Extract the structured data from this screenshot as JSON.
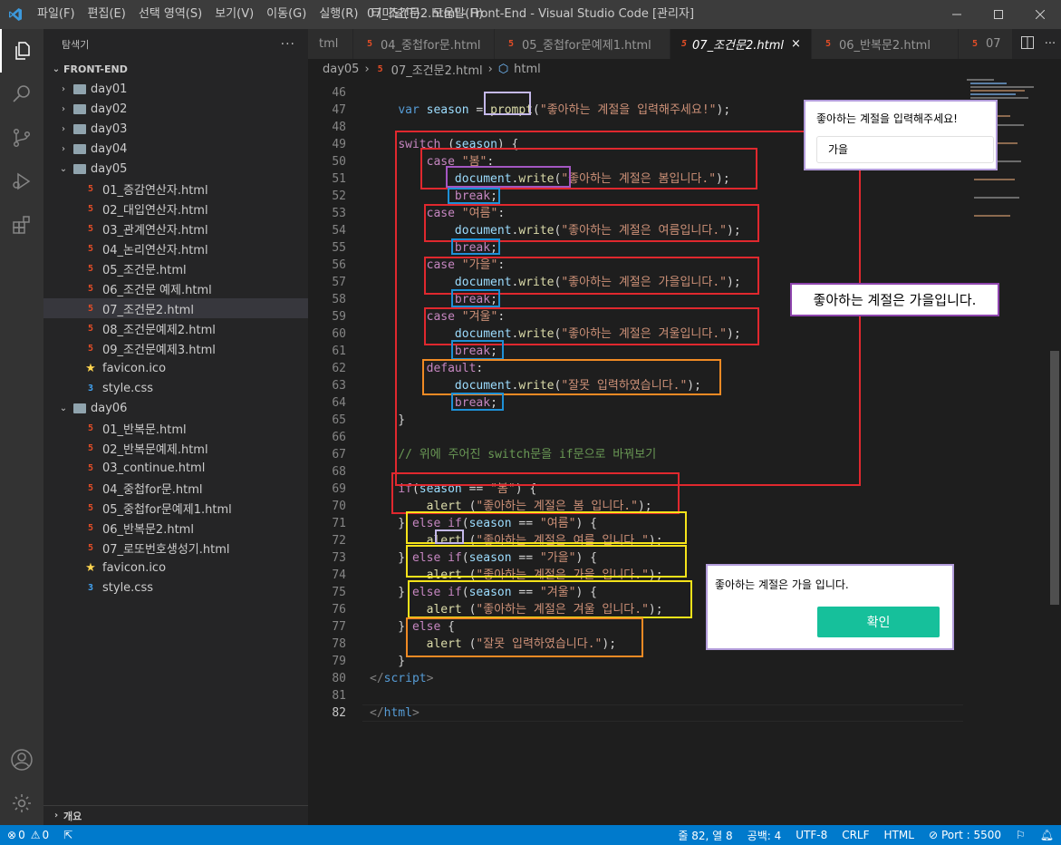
{
  "window": {
    "title": "07_조건문2.html - Front-End - Visual Studio Code [관리자]"
  },
  "menu": [
    "파일(F)",
    "편집(E)",
    "선택 영역(S)",
    "보기(V)",
    "이동(G)",
    "실행(R)",
    "터미널(T)",
    "도움말(H)"
  ],
  "sidebar": {
    "header": "탐색기",
    "section": "FRONT-END",
    "outline": "개요",
    "tree": [
      {
        "label": "day01",
        "kind": "folder",
        "open": false,
        "depth": 1
      },
      {
        "label": "day02",
        "kind": "folder",
        "open": false,
        "depth": 1
      },
      {
        "label": "day03",
        "kind": "folder",
        "open": false,
        "depth": 1
      },
      {
        "label": "day04",
        "kind": "folder",
        "open": false,
        "depth": 1
      },
      {
        "label": "day05",
        "kind": "folder",
        "open": true,
        "depth": 1
      },
      {
        "label": "01_증감연산자.html",
        "kind": "html",
        "depth": 2
      },
      {
        "label": "02_대입연산자.html",
        "kind": "html",
        "depth": 2
      },
      {
        "label": "03_관계연산자.html",
        "kind": "html",
        "depth": 2
      },
      {
        "label": "04_논리연산자.html",
        "kind": "html",
        "depth": 2
      },
      {
        "label": "05_조건문.html",
        "kind": "html",
        "depth": 2
      },
      {
        "label": "06_조건문 예제.html",
        "kind": "html",
        "depth": 2
      },
      {
        "label": "07_조건문2.html",
        "kind": "html",
        "depth": 2,
        "selected": true
      },
      {
        "label": "08_조건문예제2.html",
        "kind": "html",
        "depth": 2
      },
      {
        "label": "09_조건문예제3.html",
        "kind": "html",
        "depth": 2
      },
      {
        "label": "favicon.ico",
        "kind": "ico",
        "depth": 2
      },
      {
        "label": "style.css",
        "kind": "css",
        "depth": 2
      },
      {
        "label": "day06",
        "kind": "folder",
        "open": true,
        "depth": 1
      },
      {
        "label": "01_반복문.html",
        "kind": "html",
        "depth": 2
      },
      {
        "label": "02_반복문예제.html",
        "kind": "html",
        "depth": 2
      },
      {
        "label": "03_continue.html",
        "kind": "html",
        "depth": 2
      },
      {
        "label": "04_중첩for문.html",
        "kind": "html",
        "depth": 2
      },
      {
        "label": "05_중첩for문예제1.html",
        "kind": "html",
        "depth": 2
      },
      {
        "label": "06_반복문2.html",
        "kind": "html",
        "depth": 2
      },
      {
        "label": "07_로또번호생성기.html",
        "kind": "html",
        "depth": 2
      },
      {
        "label": "favicon.ico",
        "kind": "ico",
        "depth": 2
      },
      {
        "label": "style.css",
        "kind": "css",
        "depth": 2
      }
    ]
  },
  "tabs": [
    {
      "label": "tml",
      "icon": false
    },
    {
      "label": "04_중첩for문.html",
      "icon": true
    },
    {
      "label": "05_중첩for문예제1.html",
      "icon": true
    },
    {
      "label": "07_조건문2.html",
      "icon": true,
      "active": true,
      "close": "×"
    },
    {
      "label": "06_반복문2.html",
      "icon": true
    },
    {
      "label": "07",
      "icon": true
    }
  ],
  "breadcrumb": [
    "day05",
    "07_조건문2.html",
    "html"
  ],
  "code": [
    {
      "n": 46,
      "t": []
    },
    {
      "n": 47,
      "t": [
        [
          "    ",
          ""
        ],
        [
          "var ",
          "kw"
        ],
        [
          "season",
          "vr"
        ],
        [
          " = ",
          ""
        ],
        [
          "prompt",
          "fn"
        ],
        [
          "(",
          ""
        ],
        [
          "\"좋아하는 계절을 입력해주세요!\"",
          "st"
        ],
        [
          ");",
          ""
        ]
      ]
    },
    {
      "n": 48,
      "t": []
    },
    {
      "n": 49,
      "t": [
        [
          "    ",
          ""
        ],
        [
          "switch",
          "kc"
        ],
        [
          " (",
          ""
        ],
        [
          "season",
          "vr"
        ],
        [
          ") {",
          ""
        ]
      ]
    },
    {
      "n": 50,
      "t": [
        [
          "        ",
          ""
        ],
        [
          "case",
          "kc"
        ],
        [
          " ",
          ""
        ],
        [
          "\"봄\"",
          "st"
        ],
        [
          ":",
          ""
        ]
      ]
    },
    {
      "n": 51,
      "t": [
        [
          "            ",
          ""
        ],
        [
          "document",
          "vr"
        ],
        [
          ".",
          ""
        ],
        [
          "write",
          "fn"
        ],
        [
          "(",
          ""
        ],
        [
          "\"좋아하는 계절은 봄입니다.\"",
          "st"
        ],
        [
          ");",
          ""
        ]
      ]
    },
    {
      "n": 52,
      "t": [
        [
          "            ",
          ""
        ],
        [
          "break",
          "kc"
        ],
        [
          ";",
          ""
        ]
      ]
    },
    {
      "n": 53,
      "t": [
        [
          "        ",
          ""
        ],
        [
          "case",
          "kc"
        ],
        [
          " ",
          ""
        ],
        [
          "\"여름\"",
          "st"
        ],
        [
          ":",
          ""
        ]
      ]
    },
    {
      "n": 54,
      "t": [
        [
          "            ",
          ""
        ],
        [
          "document",
          "vr"
        ],
        [
          ".",
          ""
        ],
        [
          "write",
          "fn"
        ],
        [
          "(",
          ""
        ],
        [
          "\"좋아하는 계절은 여름입니다.\"",
          "st"
        ],
        [
          ");",
          ""
        ]
      ]
    },
    {
      "n": 55,
      "t": [
        [
          "            ",
          ""
        ],
        [
          "break",
          "kc"
        ],
        [
          ";",
          ""
        ]
      ]
    },
    {
      "n": 56,
      "t": [
        [
          "        ",
          ""
        ],
        [
          "case",
          "kc"
        ],
        [
          " ",
          ""
        ],
        [
          "\"가을\"",
          "st"
        ],
        [
          ":",
          ""
        ]
      ]
    },
    {
      "n": 57,
      "t": [
        [
          "            ",
          ""
        ],
        [
          "document",
          "vr"
        ],
        [
          ".",
          ""
        ],
        [
          "write",
          "fn"
        ],
        [
          "(",
          ""
        ],
        [
          "\"좋아하는 계절은 가을입니다.\"",
          "st"
        ],
        [
          ");",
          ""
        ]
      ]
    },
    {
      "n": 58,
      "t": [
        [
          "            ",
          ""
        ],
        [
          "break",
          "kc"
        ],
        [
          ";",
          ""
        ]
      ]
    },
    {
      "n": 59,
      "t": [
        [
          "        ",
          ""
        ],
        [
          "case",
          "kc"
        ],
        [
          " ",
          ""
        ],
        [
          "\"겨울\"",
          "st"
        ],
        [
          ":",
          ""
        ]
      ]
    },
    {
      "n": 60,
      "t": [
        [
          "            ",
          ""
        ],
        [
          "document",
          "vr"
        ],
        [
          ".",
          ""
        ],
        [
          "write",
          "fn"
        ],
        [
          "(",
          ""
        ],
        [
          "\"좋아하는 계절은 겨울입니다.\"",
          "st"
        ],
        [
          ");",
          ""
        ]
      ]
    },
    {
      "n": 61,
      "t": [
        [
          "            ",
          ""
        ],
        [
          "break",
          "kc"
        ],
        [
          ";",
          ""
        ]
      ]
    },
    {
      "n": 62,
      "t": [
        [
          "        ",
          ""
        ],
        [
          "default",
          "kc"
        ],
        [
          ":",
          ""
        ]
      ]
    },
    {
      "n": 63,
      "t": [
        [
          "            ",
          ""
        ],
        [
          "document",
          "vr"
        ],
        [
          ".",
          ""
        ],
        [
          "write",
          "fn"
        ],
        [
          "(",
          ""
        ],
        [
          "\"잘못 입력하였습니다.\"",
          "st"
        ],
        [
          ");",
          ""
        ]
      ]
    },
    {
      "n": 64,
      "t": [
        [
          "            ",
          ""
        ],
        [
          "break",
          "kc"
        ],
        [
          ";",
          ""
        ]
      ]
    },
    {
      "n": 65,
      "t": [
        [
          "    }",
          ""
        ]
      ]
    },
    {
      "n": 66,
      "t": []
    },
    {
      "n": 67,
      "t": [
        [
          "    ",
          ""
        ],
        [
          "// 위에 주어진 switch문을 if문으로 바꿔보기",
          "cm"
        ]
      ]
    },
    {
      "n": 68,
      "t": []
    },
    {
      "n": 69,
      "t": [
        [
          "    ",
          ""
        ],
        [
          "if",
          "kc"
        ],
        [
          "(",
          ""
        ],
        [
          "season",
          "vr"
        ],
        [
          " == ",
          ""
        ],
        [
          "\"봄\"",
          "st"
        ],
        [
          ") {",
          ""
        ]
      ]
    },
    {
      "n": 70,
      "t": [
        [
          "        ",
          ""
        ],
        [
          "alert",
          "fn"
        ],
        [
          " (",
          ""
        ],
        [
          "\"좋아하는 계절은 봄 입니다.\"",
          "st"
        ],
        [
          ");",
          ""
        ]
      ]
    },
    {
      "n": 71,
      "t": [
        [
          "    } ",
          ""
        ],
        [
          "else if",
          "kc"
        ],
        [
          "(",
          ""
        ],
        [
          "season",
          "vr"
        ],
        [
          " == ",
          ""
        ],
        [
          "\"여름\"",
          "st"
        ],
        [
          ") {",
          ""
        ]
      ]
    },
    {
      "n": 72,
      "t": [
        [
          "        ",
          ""
        ],
        [
          "alert",
          "fn"
        ],
        [
          " (",
          ""
        ],
        [
          "\"좋아하는 계절은 여름 입니다.\"",
          "st"
        ],
        [
          ");",
          ""
        ]
      ]
    },
    {
      "n": 73,
      "t": [
        [
          "    } ",
          ""
        ],
        [
          "else if",
          "kc"
        ],
        [
          "(",
          ""
        ],
        [
          "season",
          "vr"
        ],
        [
          " == ",
          ""
        ],
        [
          "\"가을\"",
          "st"
        ],
        [
          ") {",
          ""
        ]
      ]
    },
    {
      "n": 74,
      "t": [
        [
          "        ",
          ""
        ],
        [
          "alert",
          "fn"
        ],
        [
          " (",
          ""
        ],
        [
          "\"좋아하는 계절은 가을 입니다.\"",
          "st"
        ],
        [
          ");",
          ""
        ]
      ]
    },
    {
      "n": 75,
      "t": [
        [
          "    } ",
          ""
        ],
        [
          "else if",
          "kc"
        ],
        [
          "(",
          ""
        ],
        [
          "season",
          "vr"
        ],
        [
          " == ",
          ""
        ],
        [
          "\"겨울\"",
          "st"
        ],
        [
          ") {",
          ""
        ]
      ]
    },
    {
      "n": 76,
      "t": [
        [
          "        ",
          ""
        ],
        [
          "alert",
          "fn"
        ],
        [
          " (",
          ""
        ],
        [
          "\"좋아하는 계절은 겨울 입니다.\"",
          "st"
        ],
        [
          ");",
          ""
        ]
      ]
    },
    {
      "n": 77,
      "t": [
        [
          "    } ",
          ""
        ],
        [
          "else",
          "kc"
        ],
        [
          " {",
          ""
        ]
      ]
    },
    {
      "n": 78,
      "t": [
        [
          "        ",
          ""
        ],
        [
          "alert",
          "fn"
        ],
        [
          " (",
          ""
        ],
        [
          "\"잘못 입력하였습니다.\"",
          "st"
        ],
        [
          ");",
          ""
        ]
      ]
    },
    {
      "n": 79,
      "t": [
        [
          "    }",
          ""
        ]
      ]
    },
    {
      "n": 80,
      "t": [
        [
          "</",
          "pu"
        ],
        [
          "script",
          "tg"
        ],
        [
          ">",
          "pu"
        ]
      ]
    },
    {
      "n": 81,
      "t": []
    },
    {
      "n": 82,
      "t": [
        [
          "</",
          "pu"
        ],
        [
          "html",
          "tg"
        ],
        [
          ">",
          "pu"
        ]
      ],
      "current": true
    }
  ],
  "popups": {
    "prompt": {
      "message": "좋아하는 계절을 입력해주세요!",
      "value": "가을"
    },
    "result": "좋아하는 계절은 가을입니다.",
    "alert": {
      "message": "좋아하는 계절은 가을 입니다.",
      "button": "확인",
      "button_color": "#16c09b"
    }
  },
  "statusbar": {
    "problems": "0",
    "warnings": "0",
    "position": "줄 82, 열 8",
    "spaces": "공백: 4",
    "encoding": "UTF-8",
    "eol": "CRLF",
    "language": "HTML",
    "port": "Port : 5500"
  },
  "colors": {
    "accent": "#007acc",
    "red": "#e0282e",
    "blue": "#1e90d6",
    "purple": "#a456c2",
    "orange": "#f08a24",
    "yellow": "#f5e31a",
    "lavender": "#c4b8ea"
  }
}
